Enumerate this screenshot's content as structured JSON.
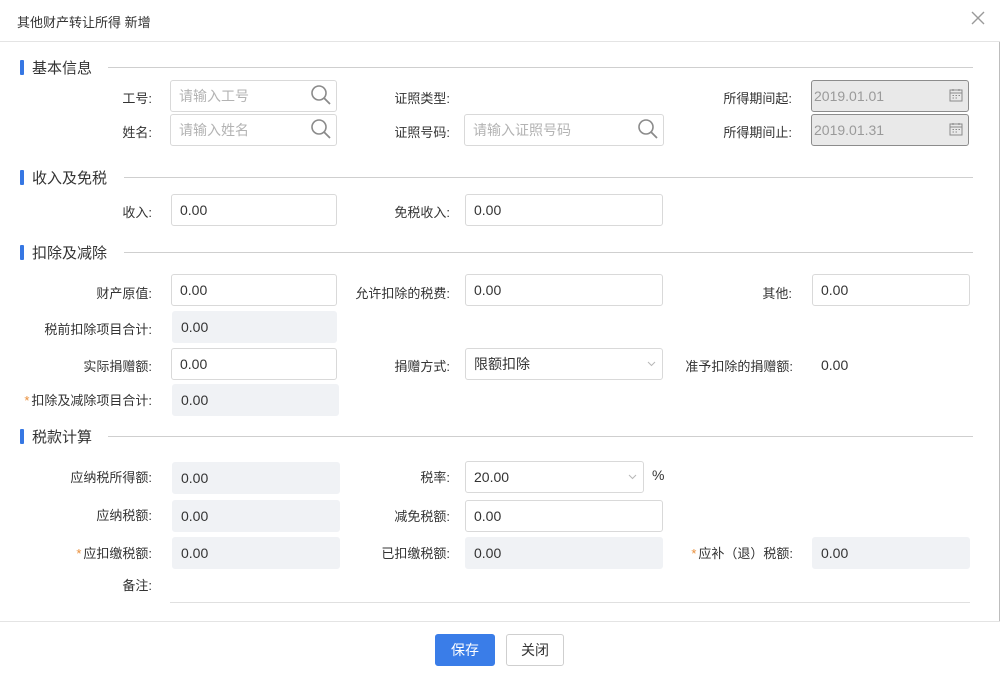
{
  "dialog": {
    "title": "其他财产转让所得 新增"
  },
  "sections": {
    "basic": "基本信息",
    "income": "收入及免税",
    "deduction": "扣除及减除",
    "tax": "税款计算"
  },
  "basic": {
    "employee_id_label": "工号:",
    "employee_id_placeholder": "请输入工号",
    "name_label": "姓名:",
    "name_placeholder": "请输入姓名",
    "id_type_label": "证照类型:",
    "id_number_label": "证照号码:",
    "id_number_placeholder": "请输入证照号码",
    "period_start_label": "所得期间起:",
    "period_start_value": "2019.01.01",
    "period_end_label": "所得期间止:",
    "period_end_value": "2019.01.31"
  },
  "income": {
    "income_label": "收入:",
    "income_value": "0.00",
    "exempt_label": "免税收入:",
    "exempt_value": "0.00"
  },
  "deduction": {
    "original_value_label": "财产原值:",
    "original_value": "0.00",
    "allowed_tax_label": "允许扣除的税费:",
    "allowed_tax_value": "0.00",
    "other_label": "其他:",
    "other_value": "0.00",
    "pretax_total_label": "税前扣除项目合计:",
    "pretax_total_value": "0.00",
    "donation_label": "实际捐赠额:",
    "donation_value": "0.00",
    "donation_method_label": "捐赠方式:",
    "donation_method_value": "限额扣除",
    "allowed_donation_label": "准予扣除的捐赠额:",
    "allowed_donation_value": "0.00",
    "deduction_total_label": "扣除及减除项目合计:",
    "deduction_total_value": "0.00",
    "required_mark": "*"
  },
  "tax": {
    "taxable_income_label": "应纳税所得额:",
    "taxable_income_value": "0.00",
    "rate_label": "税率:",
    "rate_value": "20.00",
    "rate_unit": "%",
    "tax_payable_label": "应纳税额:",
    "tax_payable_value": "0.00",
    "tax_relief_label": "减免税额:",
    "tax_relief_value": "0.00",
    "withholding_label": "应扣缴税额:",
    "withholding_value": "0.00",
    "withheld_label": "已扣缴税额:",
    "withheld_value": "0.00",
    "refund_label": "应补（退）税额:",
    "refund_value": "0.00",
    "remark_label": "备注:"
  },
  "footer": {
    "save_label": "保存",
    "close_label": "关闭"
  },
  "colors": {
    "accent": "#3a7de8",
    "required": "#e98e3a",
    "readonly_bg": "#f0f2f5"
  }
}
